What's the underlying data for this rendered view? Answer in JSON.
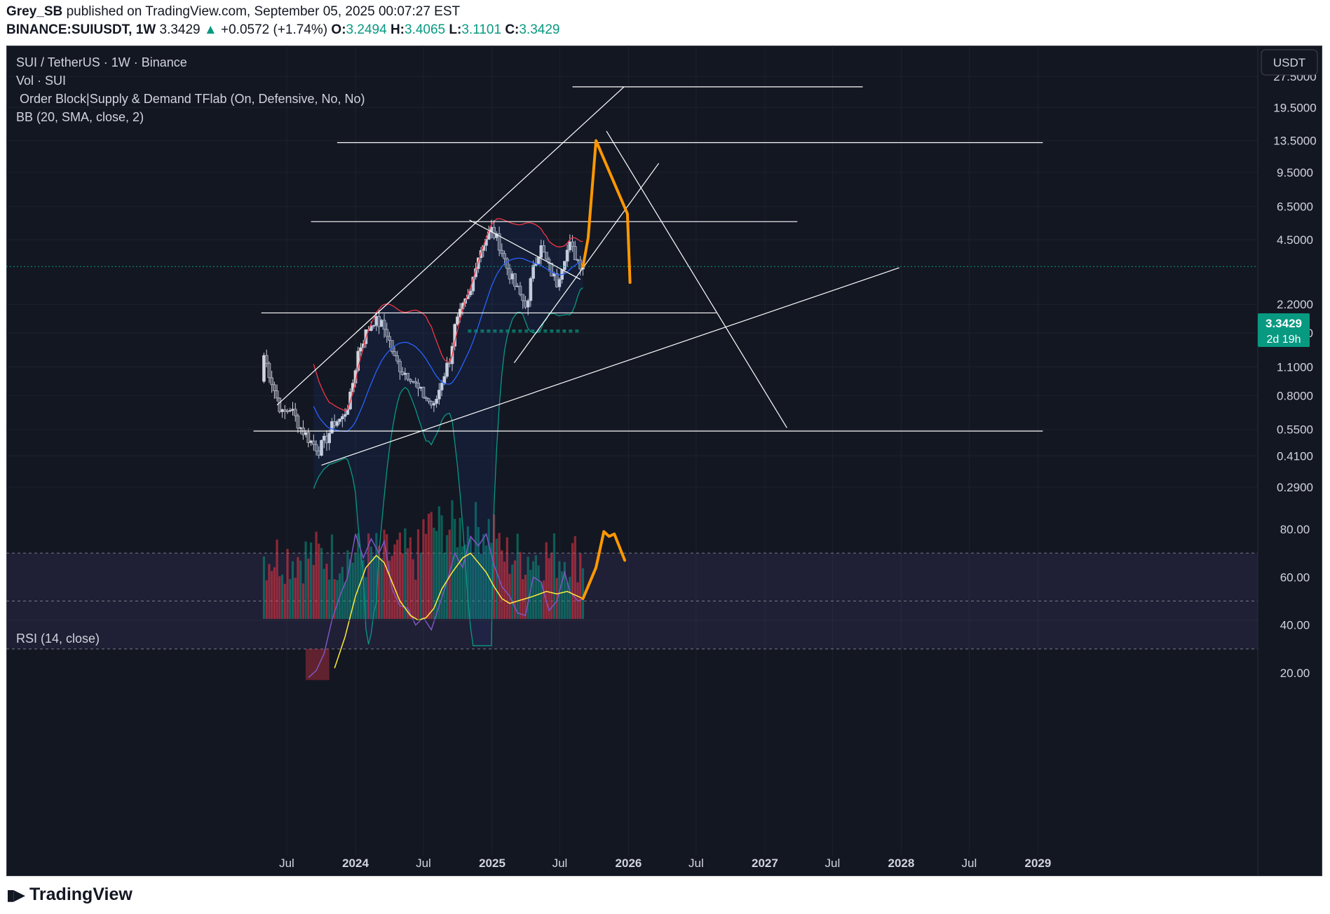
{
  "header": {
    "author": "Grey_SB",
    "published_text": "published on TradingView.com, September 05, 2025 00:07:27 EST",
    "symbol": "BINANCE:SUIUSDT, 1W",
    "last": "3.3429",
    "change": "+0.0572 (+1.74%)",
    "o_label": "O:",
    "o_value": "3.2494",
    "h_label": "H:",
    "h_value": "3.4065",
    "l_label": "L:",
    "l_value": "3.1101",
    "c_label": "C:",
    "c_value": "3.3429"
  },
  "legend": {
    "title": "SUI / TetherUS · 1W · Binance",
    "vol": "Vol · SUI",
    "order_block": " Order Block|Supply & Demand TFlab (On, Defensive, No, No)",
    "bb": "BB (20, SMA, close, 2)",
    "rsi": "RSI (14, close)"
  },
  "currency_button": "USDT",
  "price_label": {
    "value": "3.3429",
    "countdown": "2d 19h"
  },
  "footer": {
    "brand": "TradingView"
  },
  "colors": {
    "background": "#131722",
    "up": "#089981",
    "down": "#f23645",
    "bb_upper": "#f23645",
    "bb_basis": "#2962ff",
    "bb_lower": "#089981",
    "rsi": "#7e57c2",
    "rsi_ma": "#ffeb3b",
    "drawing": "#ff9800",
    "trendline": "#ffffff"
  },
  "chart_data": [
    {
      "type": "candlestick",
      "title": "SUI / TetherUS · 1W · Binance",
      "y_scale": "log",
      "y_ticks": [
        27.5,
        19.5,
        13.5,
        9.5,
        6.5,
        4.5,
        2.2,
        1.6,
        1.1,
        0.8,
        0.55,
        0.41,
        0.29
      ],
      "y_tick_labels": [
        "27.5000",
        "19.5000",
        "13.5000",
        "9.5000",
        "6.5000",
        "4.5000",
        "2.2000",
        "1.6000",
        "1.1000",
        "0.8000",
        "0.5500",
        "0.4100",
        "0.2900"
      ],
      "x_ticks": [
        "Jul",
        "2024",
        "Jul",
        "2025",
        "Jul",
        "2026",
        "Jul",
        "2027",
        "Jul",
        "2028",
        "Jul",
        "2029"
      ],
      "close_path": [
        [
          "2023-05-01",
          1.25
        ],
        [
          "2023-05-29",
          0.85
        ],
        [
          "2023-06-19",
          0.65
        ],
        [
          "2023-07-10",
          0.7
        ],
        [
          "2023-08-07",
          0.56
        ],
        [
          "2023-09-04",
          0.48
        ],
        [
          "2023-09-25",
          0.44
        ],
        [
          "2023-10-16",
          0.5
        ],
        [
          "2023-11-06",
          0.6
        ],
        [
          "2023-11-27",
          0.62
        ],
        [
          "2023-12-18",
          0.78
        ],
        [
          "2024-01-08",
          1.3
        ],
        [
          "2024-01-29",
          1.6
        ],
        [
          "2024-02-19",
          1.85
        ],
        [
          "2024-03-11",
          1.75
        ],
        [
          "2024-03-25",
          1.6
        ],
        [
          "2024-04-15",
          1.2
        ],
        [
          "2024-05-06",
          1.05
        ],
        [
          "2024-05-27",
          1.0
        ],
        [
          "2024-06-17",
          0.85
        ],
        [
          "2024-07-08",
          0.78
        ],
        [
          "2024-07-29",
          0.7
        ],
        [
          "2024-08-19",
          0.95
        ],
        [
          "2024-09-09",
          1.2
        ],
        [
          "2024-09-23",
          1.7
        ],
        [
          "2024-10-14",
          2.1
        ],
        [
          "2024-11-04",
          2.5
        ],
        [
          "2024-11-18",
          3.5
        ],
        [
          "2024-12-09",
          4.4
        ],
        [
          "2024-12-30",
          5.0
        ],
        [
          "2025-01-20",
          4.3
        ],
        [
          "2025-02-10",
          3.3
        ],
        [
          "2025-03-03",
          2.7
        ],
        [
          "2025-03-24",
          2.3
        ],
        [
          "2025-04-07",
          2.2
        ],
        [
          "2025-04-21",
          3.5
        ],
        [
          "2025-05-12",
          4.1
        ],
        [
          "2025-06-02",
          3.3
        ],
        [
          "2025-06-23",
          2.8
        ],
        [
          "2025-07-14",
          3.8
        ],
        [
          "2025-07-28",
          4.2
        ],
        [
          "2025-08-18",
          3.6
        ],
        [
          "2025-09-01",
          3.34
        ]
      ],
      "last_close": 3.3429,
      "horizontal_levels": [
        24.5,
        13.2,
        5.5,
        2.0,
        0.54
      ],
      "projection_path": [
        [
          "2025-09-01",
          3.34
        ],
        [
          "2025-09-15",
          4.6
        ],
        [
          "2025-10-06",
          13.5
        ],
        [
          "2025-11-17",
          9.0
        ],
        [
          "2025-12-29",
          6.0
        ],
        [
          "2026-01-05",
          2.8
        ]
      ]
    },
    {
      "type": "line",
      "title": "RSI (14, close)",
      "y_ticks": [
        80,
        60,
        40,
        20
      ],
      "y_tick_labels": [
        "80.00",
        "60.00",
        "40.00",
        "20.00"
      ],
      "bands": {
        "upper": 70,
        "middle": 50,
        "lower": 30
      },
      "series": [
        {
          "values": [
            [
              "2023-08-28",
              18
            ],
            [
              "2023-09-18",
              21
            ],
            [
              "2023-10-09",
              28
            ],
            [
              "2023-10-30",
              42
            ],
            [
              "2023-11-20",
              52
            ],
            [
              "2023-12-11",
              60
            ],
            [
              "2024-01-01",
              78
            ],
            [
              "2024-01-22",
              68
            ],
            [
              "2024-02-12",
              76
            ],
            [
              "2024-03-04",
              70
            ],
            [
              "2024-03-18",
              75
            ],
            [
              "2024-04-08",
              55
            ],
            [
              "2024-04-29",
              48
            ],
            [
              "2024-05-20",
              47
            ],
            [
              "2024-06-10",
              40
            ],
            [
              "2024-07-01",
              43
            ],
            [
              "2024-07-22",
              38
            ],
            [
              "2024-08-12",
              48
            ],
            [
              "2024-09-02",
              58
            ],
            [
              "2024-09-23",
              70
            ],
            [
              "2024-10-14",
              64
            ],
            [
              "2024-11-04",
              77
            ],
            [
              "2024-11-25",
              73
            ],
            [
              "2024-12-16",
              78
            ],
            [
              "2025-01-06",
              65
            ],
            [
              "2025-01-27",
              56
            ],
            [
              "2025-02-17",
              52
            ],
            [
              "2025-03-10",
              45
            ],
            [
              "2025-03-31",
              44
            ],
            [
              "2025-04-21",
              60
            ],
            [
              "2025-05-12",
              58
            ],
            [
              "2025-06-02",
              46
            ],
            [
              "2025-06-23",
              50
            ],
            [
              "2025-07-14",
              62
            ],
            [
              "2025-07-28",
              54
            ],
            [
              "2025-08-18",
              50
            ],
            [
              "2025-09-01",
              51
            ]
          ]
        },
        {
          "values": [
            [
              "2023-11-06",
              22
            ],
            [
              "2023-12-04",
              35
            ],
            [
              "2024-01-01",
              52
            ],
            [
              "2024-01-29",
              64
            ],
            [
              "2024-02-26",
              69
            ],
            [
              "2024-03-18",
              66
            ],
            [
              "2024-04-08",
              58
            ],
            [
              "2024-04-29",
              50
            ],
            [
              "2024-05-27",
              44
            ],
            [
              "2024-06-17",
              42
            ],
            [
              "2024-07-08",
              43
            ],
            [
              "2024-07-29",
              47
            ],
            [
              "2024-08-19",
              55
            ],
            [
              "2024-09-16",
              62
            ],
            [
              "2024-10-14",
              68
            ],
            [
              "2024-11-04",
              70
            ],
            [
              "2024-11-25",
              66
            ],
            [
              "2024-12-16",
              62
            ],
            [
              "2025-01-06",
              56
            ],
            [
              "2025-01-27",
              51
            ],
            [
              "2025-02-17",
              49
            ],
            [
              "2025-03-10",
              50
            ],
            [
              "2025-03-31",
              51
            ],
            [
              "2025-04-21",
              52
            ],
            [
              "2025-05-26",
              54
            ],
            [
              "2025-06-23",
              53
            ],
            [
              "2025-07-21",
              54
            ],
            [
              "2025-08-18",
              52
            ],
            [
              "2025-09-01",
              51
            ]
          ]
        }
      ],
      "projection_path": [
        [
          "2025-09-01",
          51
        ],
        [
          "2025-10-06",
          64
        ],
        [
          "2025-10-27",
          79
        ],
        [
          "2025-11-10",
          77
        ],
        [
          "2025-11-24",
          78
        ],
        [
          "2025-12-22",
          67
        ]
      ]
    }
  ]
}
